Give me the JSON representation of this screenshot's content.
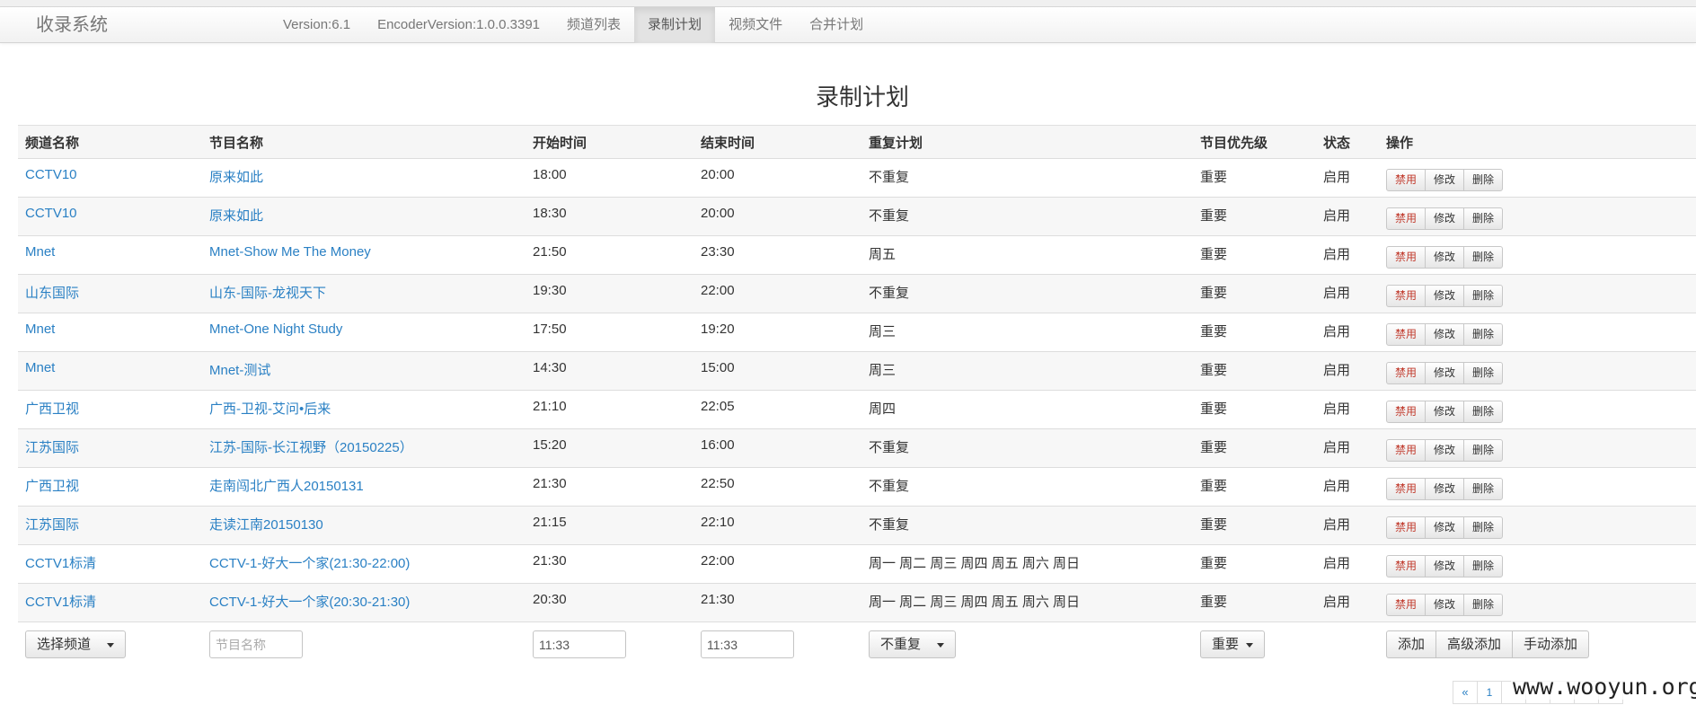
{
  "app": {
    "brand": "收录系统",
    "nav": [
      {
        "label": "Version:6.1"
      },
      {
        "label": "EncoderVersion:1.0.0.3391"
      },
      {
        "label": "频道列表"
      },
      {
        "label": "录制计划"
      },
      {
        "label": "视频文件"
      },
      {
        "label": "合并计划"
      }
    ],
    "active_nav": "录制计划"
  },
  "page": {
    "title": "录制计划"
  },
  "table": {
    "headers": [
      "频道名称",
      "节目名称",
      "开始时间",
      "结束时间",
      "重复计划",
      "节目优先级",
      "状态",
      "操作"
    ],
    "rows": [
      {
        "channel": "CCTV10",
        "program": "原来如此",
        "start": "18:00",
        "end": "20:00",
        "repeat": "不重复",
        "priority": "重要",
        "status": "启用"
      },
      {
        "channel": "CCTV10",
        "program": "原来如此",
        "start": "18:30",
        "end": "20:00",
        "repeat": "不重复",
        "priority": "重要",
        "status": "启用"
      },
      {
        "channel": "Mnet",
        "program": "Mnet-Show Me The Money",
        "start": "21:50",
        "end": "23:30",
        "repeat": "周五",
        "priority": "重要",
        "status": "启用"
      },
      {
        "channel": "山东国际",
        "program": "山东-国际-龙视天下",
        "start": "19:30",
        "end": "22:00",
        "repeat": "不重复",
        "priority": "重要",
        "status": "启用"
      },
      {
        "channel": "Mnet",
        "program": "Mnet-One Night Study",
        "start": "17:50",
        "end": "19:20",
        "repeat": "周三",
        "priority": "重要",
        "status": "启用"
      },
      {
        "channel": "Mnet",
        "program": "Mnet-测试",
        "start": "14:30",
        "end": "15:00",
        "repeat": "周三",
        "priority": "重要",
        "status": "启用"
      },
      {
        "channel": "广西卫视",
        "program": "广西-卫视-艾问•后来",
        "start": "21:10",
        "end": "22:05",
        "repeat": "周四",
        "priority": "重要",
        "status": "启用"
      },
      {
        "channel": "江苏国际",
        "program": "江苏-国际-长江视野（20150225）",
        "start": "15:20",
        "end": "16:00",
        "repeat": "不重复",
        "priority": "重要",
        "status": "启用"
      },
      {
        "channel": "广西卫视",
        "program": "走南闯北广西人20150131",
        "start": "21:30",
        "end": "22:50",
        "repeat": "不重复",
        "priority": "重要",
        "status": "启用"
      },
      {
        "channel": "江苏国际",
        "program": "走读江南20150130",
        "start": "21:15",
        "end": "22:10",
        "repeat": "不重复",
        "priority": "重要",
        "status": "启用"
      },
      {
        "channel": "CCTV1标清",
        "program": "CCTV-1-好大一个家(21:30-22:00)",
        "start": "21:30",
        "end": "22:00",
        "repeat": "周一 周二 周三 周四 周五 周六 周日",
        "priority": "重要",
        "status": "启用"
      },
      {
        "channel": "CCTV1标清",
        "program": "CCTV-1-好大一个家(20:30-21:30)",
        "start": "20:30",
        "end": "21:30",
        "repeat": "周一 周二 周三 周四 周五 周六 周日",
        "priority": "重要",
        "status": "启用"
      }
    ],
    "row_actions": {
      "disable": "禁用",
      "edit": "修改",
      "delete": "删除"
    }
  },
  "form": {
    "channel_select": "选择频道",
    "program_placeholder": "节目名称",
    "start_value": "11:33",
    "end_value": "11:33",
    "repeat_select": "不重复",
    "priority_select": "重要",
    "add": "添加",
    "advanced_add": "高级添加",
    "manual_add": "手动添加"
  },
  "pagination": {
    "prev": "«",
    "page1": "1"
  },
  "watermark": "www.wooyun.org",
  "colors": {
    "link": "#2a80c4",
    "danger": "#c0392b",
    "nav_active": "#e3e3e3"
  }
}
